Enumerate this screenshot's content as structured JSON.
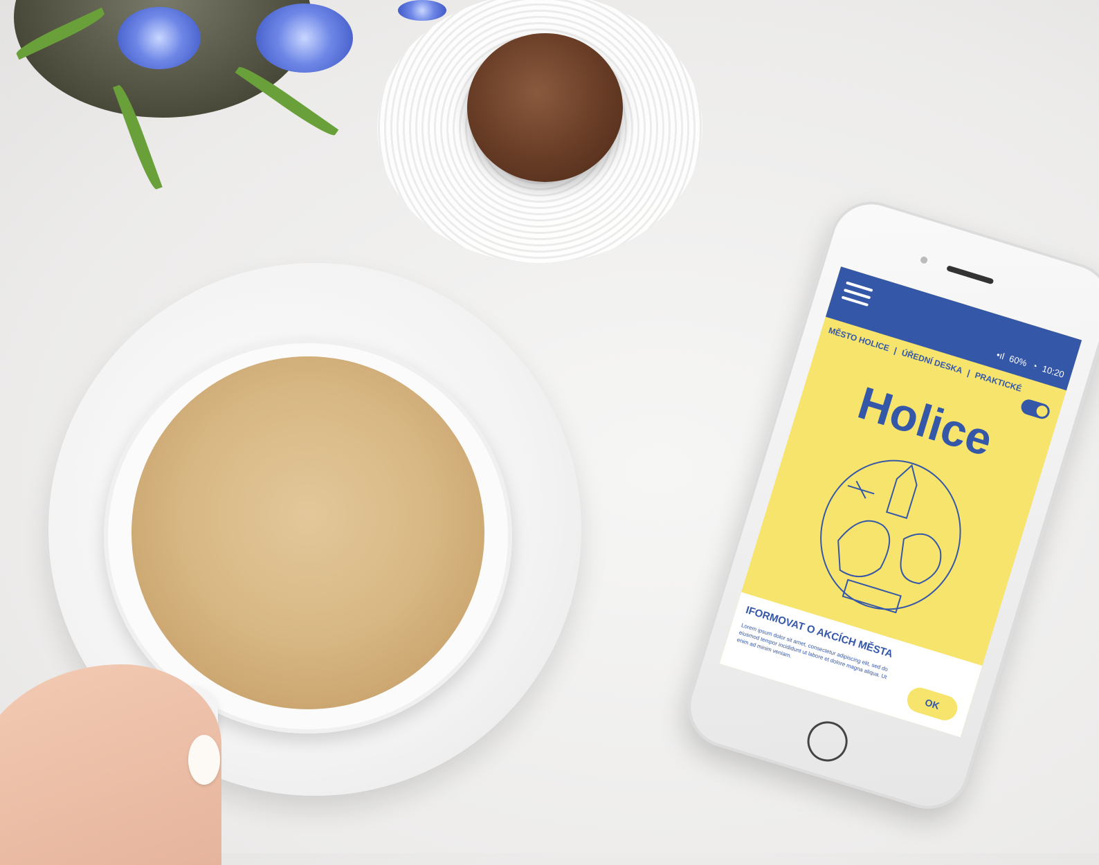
{
  "app": {
    "status": {
      "signal": "•ıl",
      "battery": "60%",
      "time": "10:20"
    },
    "nav": [
      {
        "label": "MĚSTO HOLICE"
      },
      {
        "label": "ÚŘEDNÍ DESKA"
      },
      {
        "label": "PRAKTICKÉ"
      }
    ],
    "separator": "|",
    "title": "Holice",
    "banner": {
      "title": "IFORMOVAT O AKCÍCH MĚSTA",
      "text": "Lorem ipsum dolor sit amet, consectetur adipiscing elit, sed do eiusmod tempor incididunt ut labore et dolore magna aliqua. Ut enim ad minim veniam.",
      "ok_label": "OK"
    }
  },
  "colors": {
    "primary": "#3557a8",
    "accent": "#f6e46c"
  },
  "icons": {
    "menu": "hamburger-menu-icon",
    "toggle": "toggle-switch-icon"
  }
}
